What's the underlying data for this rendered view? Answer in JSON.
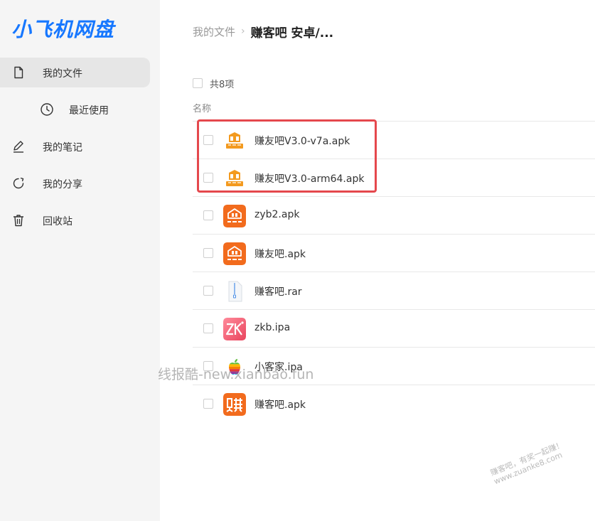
{
  "app": {
    "logo_text": "小飞机网盘",
    "logo_color": "#1677ff"
  },
  "sidebar": {
    "items": [
      {
        "label": "我的文件",
        "icon": "file-icon",
        "active": true
      },
      {
        "label": "最近使用",
        "icon": "clock-icon",
        "sub": true
      },
      {
        "label": "我的笔记",
        "icon": "pencil-icon"
      },
      {
        "label": "我的分享",
        "icon": "share-icon"
      },
      {
        "label": "回收站",
        "icon": "trash-icon"
      }
    ]
  },
  "breadcrumb": {
    "root": "我的文件",
    "separator": "›",
    "current": "赚客吧 安卓/..."
  },
  "list": {
    "count_label": "共8项",
    "column_name": "名称",
    "files": [
      {
        "name": "赚友吧V3.0-v7a.apk",
        "icon": "zyb-logo-icon"
      },
      {
        "name": "赚友吧V3.0-arm64.apk",
        "icon": "zyb-logo-icon"
      },
      {
        "name": "zyb2.apk",
        "icon": "zyb-orange-icon"
      },
      {
        "name": "赚友吧.apk",
        "icon": "zyb-orange-icon"
      },
      {
        "name": "赚客吧.rar",
        "icon": "archive-icon"
      },
      {
        "name": "zkb.ipa",
        "icon": "zk-icon"
      },
      {
        "name": "小客家.ipa",
        "icon": "apple-icon"
      },
      {
        "name": "赚客吧.apk",
        "icon": "zhuan-icon"
      }
    ]
  },
  "highlight_color": "#e5484d",
  "watermarks": {
    "center": "线报酷-new.xianbao.fun",
    "corner_line1": "赚客吧，有奖一起赚！",
    "corner_line2": "www.zuanke8.com"
  }
}
